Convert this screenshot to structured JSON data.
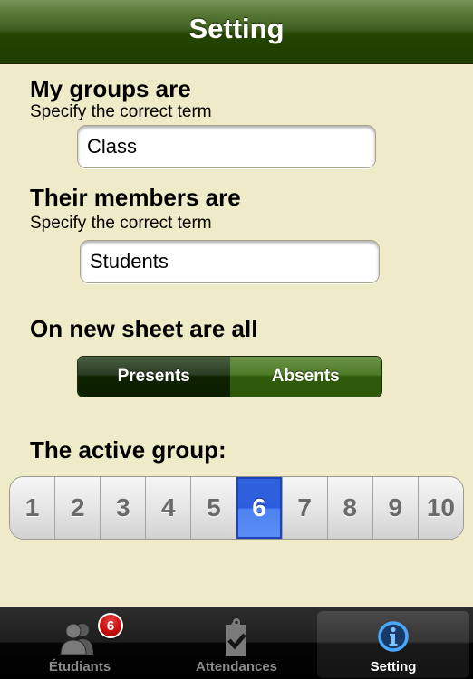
{
  "navbar": {
    "title": "Setting"
  },
  "groups": {
    "heading": "My groups are",
    "subheading": "Specify the correct term",
    "value": "Class"
  },
  "members": {
    "heading": "Their members are",
    "subheading": "Specify the correct term",
    "value": "Students"
  },
  "new_sheet": {
    "heading": "On new sheet are all",
    "options": [
      "Presents",
      "Absents"
    ],
    "selected": "Presents"
  },
  "active_group": {
    "heading": "The active group:",
    "options": [
      "1",
      "2",
      "3",
      "4",
      "5",
      "6",
      "7",
      "8",
      "9",
      "10"
    ],
    "selected": "6"
  },
  "tabbar": {
    "tabs": [
      {
        "label": "Étudiants",
        "icon": "people-icon",
        "badge": "6"
      },
      {
        "label": "Attendances",
        "icon": "clipboard-check-icon"
      },
      {
        "label": "Setting",
        "icon": "info-icon",
        "active": true
      }
    ]
  },
  "colors": {
    "background": "#efebc8",
    "navbar_green": "#244400",
    "selected_blue": "#2d5ee0",
    "badge_red": "#c40c0c"
  }
}
